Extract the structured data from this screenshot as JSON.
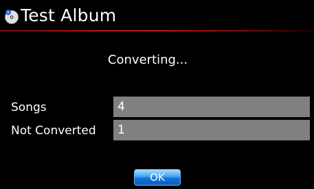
{
  "header": {
    "icon": "album-disc-icon",
    "title": "Test Album"
  },
  "dialog": {
    "status": "Converting...",
    "rows": [
      {
        "label": "Songs",
        "value": "4"
      },
      {
        "label": "Not Converted",
        "value": "1"
      }
    ],
    "ok_label": "OK"
  },
  "colors": {
    "background": "#000000",
    "title_underline": "#c21c1c",
    "field_background": "#808080",
    "button_accent": "#1f86e6"
  }
}
